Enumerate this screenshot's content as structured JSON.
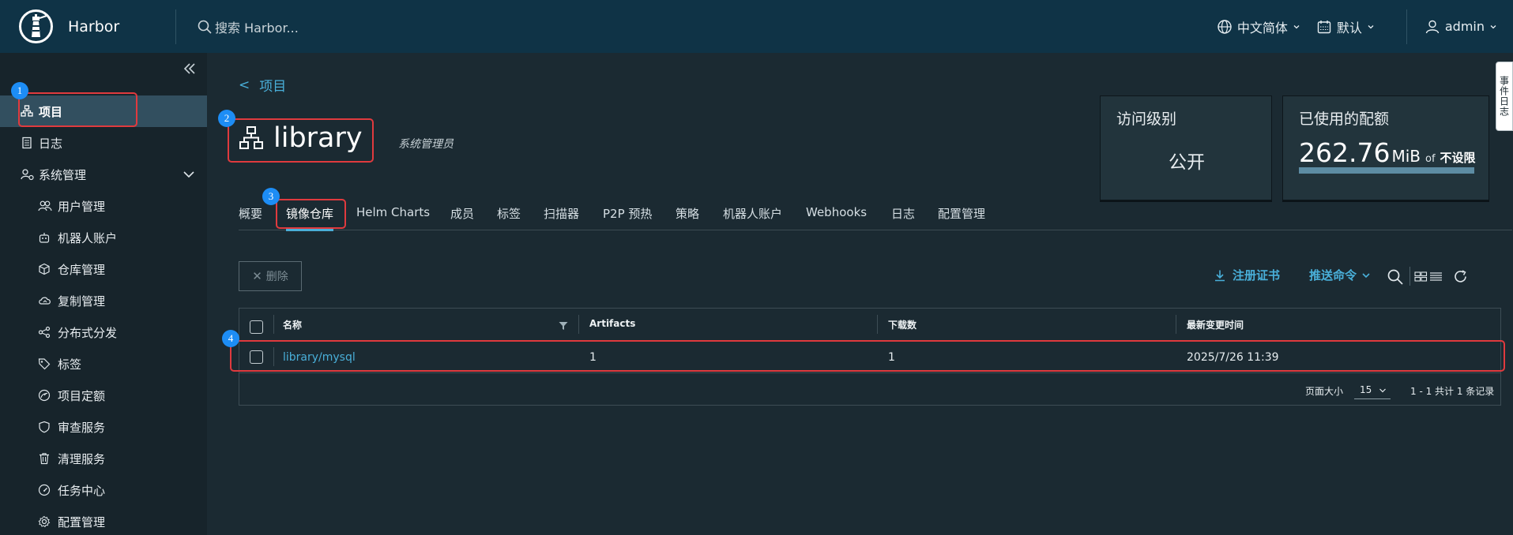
{
  "header": {
    "app_name": "Harbor",
    "search_placeholder": "搜索 Harbor...",
    "language": "中文简体",
    "date_format": "默认",
    "user": "admin"
  },
  "sidebar": {
    "items": [
      {
        "label": "项目",
        "icon": "project-icon",
        "active": true
      },
      {
        "label": "日志",
        "icon": "log-icon"
      },
      {
        "label": "系统管理",
        "icon": "admin-icon",
        "expanded": true
      },
      {
        "label": "用户管理",
        "icon": "users-icon"
      },
      {
        "label": "机器人账户",
        "icon": "robot-icon"
      },
      {
        "label": "仓库管理",
        "icon": "registry-icon"
      },
      {
        "label": "复制管理",
        "icon": "replication-icon"
      },
      {
        "label": "分布式分发",
        "icon": "share-icon"
      },
      {
        "label": "标签",
        "icon": "tag-icon"
      },
      {
        "label": "项目定额",
        "icon": "quota-icon"
      },
      {
        "label": "审查服务",
        "icon": "shield-icon"
      },
      {
        "label": "清理服务",
        "icon": "trash-icon"
      },
      {
        "label": "任务中心",
        "icon": "dashboard-icon"
      },
      {
        "label": "配置管理",
        "icon": "gear-icon"
      }
    ]
  },
  "breadcrumb": {
    "back": "<",
    "label": "项目"
  },
  "project": {
    "name": "library",
    "role": "系统管理员"
  },
  "cards": {
    "access": {
      "title": "访问级别",
      "value": "公开"
    },
    "quota": {
      "title": "已使用的配额",
      "number": "262.76",
      "unit": "MiB",
      "of": "of",
      "limit": "不设限",
      "fill_fraction": 1.0
    }
  },
  "tabs": [
    "概要",
    "镜像仓库",
    "Helm Charts",
    "成员",
    "标签",
    "扫描器",
    "P2P 预热",
    "策略",
    "机器人账户",
    "Webhooks",
    "日志",
    "配置管理"
  ],
  "active_tab": "镜像仓库",
  "toolbar": {
    "delete": "删除",
    "register_cert": "注册证书",
    "push_command": "推送命令"
  },
  "table": {
    "columns": [
      "名称",
      "Artifacts",
      "下载数",
      "最新变更时间"
    ],
    "rows": [
      {
        "name": "library/mysql",
        "artifacts": "1",
        "pulls": "1",
        "updated": "2025/7/26 11:39"
      }
    ],
    "footer": {
      "page_size_label": "页面大小",
      "page_size": "15",
      "total": "1 - 1 共计 1 条记录"
    }
  },
  "annotations": [
    "1",
    "2",
    "3",
    "4"
  ],
  "event_log_tab": "事件日志",
  "colors": {
    "accent": "#49afd9",
    "header_bg": "#0f3346",
    "annotation_red": "#e03a3e",
    "annotation_blue": "#1d8df5"
  }
}
